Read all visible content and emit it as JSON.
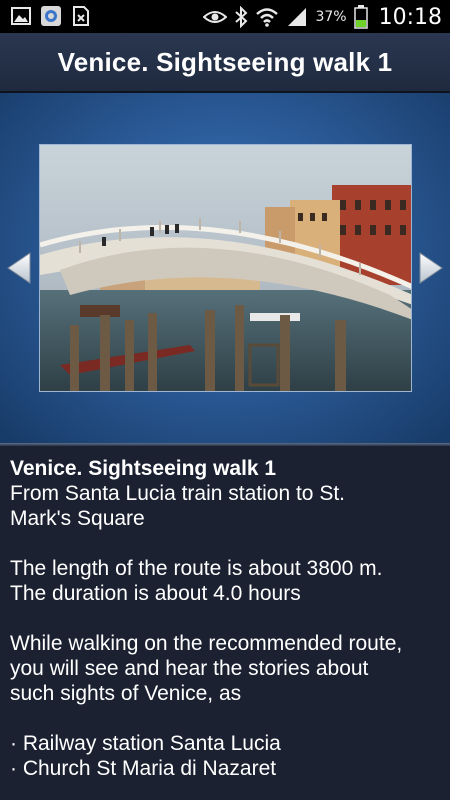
{
  "status_bar": {
    "battery": "37%",
    "time": "10:18"
  },
  "header": {
    "title": "Venice. Sightseeing walk 1"
  },
  "content": {
    "title": "Venice. Sightseeing walk 1",
    "subtitle_line1": "From Santa Lucia train station to St.",
    "subtitle_line2": "Mark's Square",
    "length_text": "The length of the route is about 3800 m.",
    "duration_text": "The duration is about 4.0 hours",
    "intro_line1": "While walking on the recommended route,",
    "intro_line2": "you will see and hear the stories about",
    "intro_line3": "such sights of Venice, as",
    "sights": [
      "· Railway station Santa Lucia",
      "· Church St  Maria di Nazaret"
    ]
  },
  "colors": {
    "background": "#1b2130",
    "title_bar": "#2a3750",
    "gallery_center": "#3f7cc4",
    "gallery_edge": "#173a66"
  },
  "icons": [
    "gallery-icon",
    "browser-icon",
    "file-icon",
    "eye-icon",
    "bluetooth-icon",
    "wifi-icon",
    "signal-icon",
    "battery-icon",
    "arrow-left-icon",
    "arrow-right-icon"
  ]
}
